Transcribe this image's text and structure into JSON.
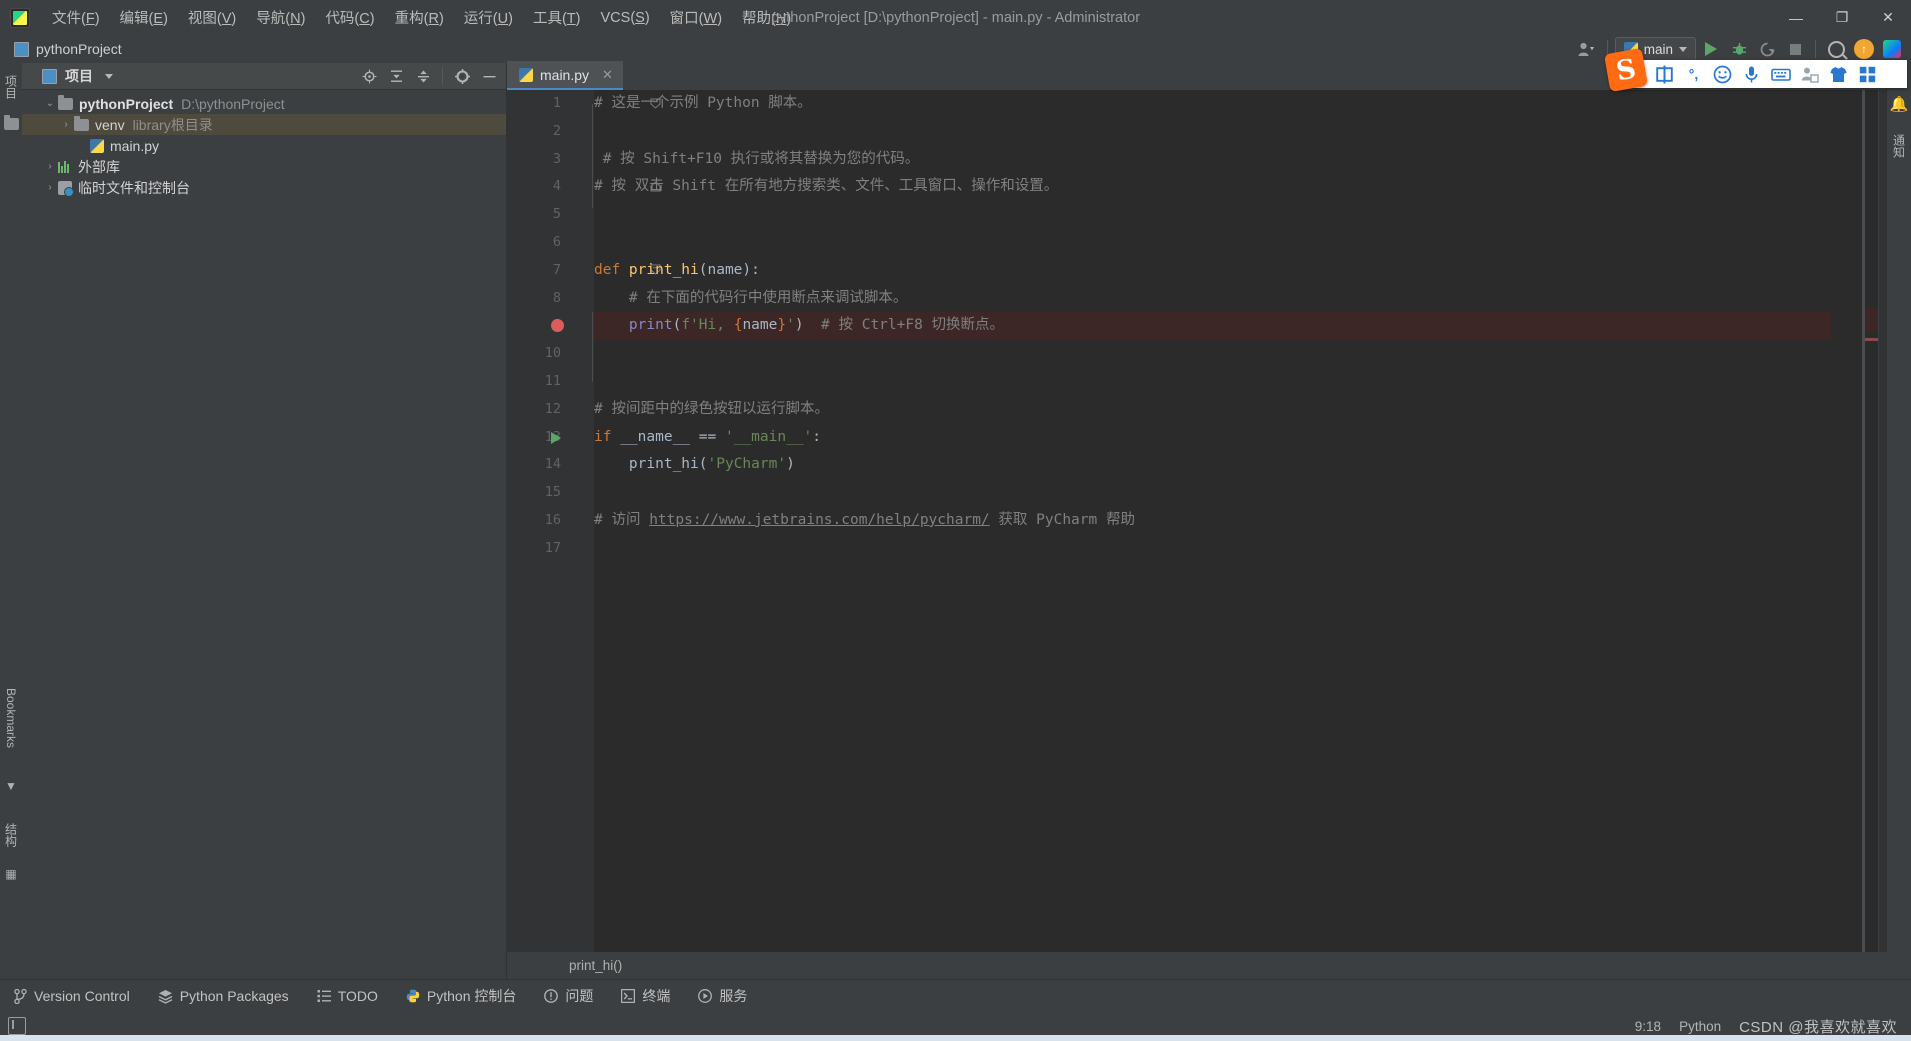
{
  "window": {
    "title": "pythonProject [D:\\pythonProject] - main.py - Administrator",
    "logo": "pycharm-logo",
    "minimize": "—",
    "maximize": "❐",
    "close": "✕"
  },
  "menubar": {
    "items": [
      {
        "label": "文件(F)",
        "name": "menu-file"
      },
      {
        "label": "编辑(E)",
        "name": "menu-edit"
      },
      {
        "label": "视图(V)",
        "name": "menu-view"
      },
      {
        "label": "导航(N)",
        "name": "menu-navigate"
      },
      {
        "label": "代码(C)",
        "name": "menu-code"
      },
      {
        "label": "重构(R)",
        "name": "menu-refactor"
      },
      {
        "label": "运行(U)",
        "name": "menu-run"
      },
      {
        "label": "工具(T)",
        "name": "menu-tools"
      },
      {
        "label": "VCS(S)",
        "name": "menu-vcs"
      },
      {
        "label": "窗口(W)",
        "name": "menu-window"
      },
      {
        "label": "帮助(H)",
        "name": "menu-help"
      }
    ]
  },
  "navbar": {
    "breadcrumb": "pythonProject",
    "run_config": "main",
    "icons": {
      "account": "account-icon",
      "run": "run-icon",
      "debug": "debug-icon",
      "coverage": "coverage-icon",
      "stop": "stop-icon",
      "search": "search-everywhere-icon",
      "update": "update-icon",
      "ide_features": "ide-features-trainer-icon",
      "more": "more-options-icon",
      "notifications": "notifications-icon"
    }
  },
  "left_strip": {
    "structure_label": "结构",
    "bookmarks_label": "Bookmarks",
    "project_label": "项目"
  },
  "right_strip": {
    "notifications_label": "通知"
  },
  "project_panel": {
    "title": "项目",
    "toolbar": {
      "locate": "locate-icon",
      "expand_all": "expand-all-icon",
      "collapse_all": "collapse-all-icon",
      "settings": "settings-gear-icon",
      "hide": "hide-panel-icon"
    },
    "tree": [
      {
        "name": "pythonProject",
        "path": "D:\\pythonProject",
        "twisty": "⌄",
        "icon": "folder-icon",
        "depth": 0,
        "bold": true,
        "selected": false
      },
      {
        "name": "venv",
        "path": "library根目录",
        "twisty": "›",
        "icon": "folder-icon",
        "depth": 1,
        "bold": false,
        "selected": true
      },
      {
        "name": "main.py",
        "path": "",
        "twisty": "",
        "icon": "python-file-icon",
        "depth": 2,
        "bold": false,
        "selected": false
      },
      {
        "name": "外部库",
        "path": "",
        "twisty": "›",
        "icon": "external-libraries-icon",
        "depth": 0,
        "bold": false,
        "selected": false
      },
      {
        "name": "临时文件和控制台",
        "path": "",
        "twisty": "›",
        "icon": "scratches-consoles-icon",
        "depth": 0,
        "bold": false,
        "selected": false
      }
    ]
  },
  "editor": {
    "tab": {
      "label": "main.py",
      "icon": "python-file-icon",
      "close": "✕"
    },
    "breadcrumb": "print_hi()",
    "inspection_status": "no-errors-checkmark",
    "lines": [
      {
        "n": 1,
        "marker": "",
        "fold": "minus",
        "hl": false,
        "tokens": [
          {
            "t": "# 这是一个示例 Python 脚本。",
            "c": "c-cmt"
          }
        ]
      },
      {
        "n": 2,
        "marker": "",
        "fold": "",
        "hl": false,
        "tokens": []
      },
      {
        "n": 3,
        "marker": "",
        "fold": "",
        "hl": false,
        "tokens": [
          {
            "t": " # 按 Shift+F10 执行或将其替换为您的代码。",
            "c": "c-cmt"
          }
        ]
      },
      {
        "n": 4,
        "marker": "",
        "fold": "end",
        "hl": false,
        "tokens": [
          {
            "t": "# 按 双击 Shift 在所有地方搜索类、文件、工具窗口、操作和设置。",
            "c": "c-cmt"
          }
        ]
      },
      {
        "n": 5,
        "marker": "",
        "fold": "",
        "hl": false,
        "tokens": []
      },
      {
        "n": 6,
        "marker": "",
        "fold": "",
        "hl": false,
        "tokens": []
      },
      {
        "n": 7,
        "marker": "",
        "fold": "minus",
        "hl": false,
        "tokens": [
          {
            "t": "def ",
            "c": "c-kw"
          },
          {
            "t": "print_hi",
            "c": "c-fn"
          },
          {
            "t": "(name):",
            "c": "c-plain"
          }
        ]
      },
      {
        "n": 8,
        "marker": "",
        "fold": "",
        "hl": false,
        "tokens": [
          {
            "t": "    # 在下面的代码行中使用断点来调试脚本。",
            "c": "c-cmt"
          }
        ]
      },
      {
        "n": 9,
        "marker": "breakpoint",
        "fold": "end",
        "hl": true,
        "tokens": [
          {
            "t": "    ",
            "c": "c-plain"
          },
          {
            "t": "print",
            "c": "c-builtin"
          },
          {
            "t": "(",
            "c": "c-plain"
          },
          {
            "t": "f'Hi, ",
            "c": "c-str"
          },
          {
            "t": "{",
            "c": "c-fstr-brace"
          },
          {
            "t": "name",
            "c": "c-plain"
          },
          {
            "t": "}",
            "c": "c-fstr-brace"
          },
          {
            "t": "'",
            "c": "c-str"
          },
          {
            "t": ")",
            "c": "c-plain"
          },
          {
            "t": "  # 按 Ctrl+F8 切换断点。",
            "c": "c-cmt"
          }
        ]
      },
      {
        "n": 10,
        "marker": "",
        "fold": "",
        "hl": false,
        "tokens": []
      },
      {
        "n": 11,
        "marker": "",
        "fold": "",
        "hl": false,
        "tokens": []
      },
      {
        "n": 12,
        "marker": "",
        "fold": "",
        "hl": false,
        "tokens": [
          {
            "t": "# 按间距中的绿色按钮以运行脚本。",
            "c": "c-cmt"
          }
        ]
      },
      {
        "n": 13,
        "marker": "run",
        "fold": "",
        "hl": false,
        "tokens": [
          {
            "t": "if ",
            "c": "c-kw"
          },
          {
            "t": "__name__ ",
            "c": "c-plain"
          },
          {
            "t": "== ",
            "c": "c-plain"
          },
          {
            "t": "'__main__'",
            "c": "c-str"
          },
          {
            "t": ":",
            "c": "c-plain"
          }
        ]
      },
      {
        "n": 14,
        "marker": "",
        "fold": "",
        "hl": false,
        "tokens": [
          {
            "t": "    print_hi(",
            "c": "c-plain"
          },
          {
            "t": "'PyCharm'",
            "c": "c-str"
          },
          {
            "t": ")",
            "c": "c-plain"
          }
        ]
      },
      {
        "n": 15,
        "marker": "",
        "fold": "",
        "hl": false,
        "tokens": []
      },
      {
        "n": 16,
        "marker": "",
        "fold": "",
        "hl": false,
        "tokens": [
          {
            "t": "# 访问 ",
            "c": "c-cmt"
          },
          {
            "t": "https://www.jetbrains.com/help/pycharm/",
            "c": "c-url"
          },
          {
            "t": " 获取 PyCharm 帮助",
            "c": "c-cmt"
          }
        ]
      },
      {
        "n": 17,
        "marker": "",
        "fold": "",
        "hl": false,
        "tokens": []
      }
    ]
  },
  "bottom_bar": {
    "items": [
      {
        "label": "Version Control",
        "icon": "branch-icon",
        "name": "tool-version-control"
      },
      {
        "label": "Python Packages",
        "icon": "packages-icon",
        "name": "tool-python-packages"
      },
      {
        "label": "TODO",
        "icon": "todo-icon",
        "name": "tool-todo"
      },
      {
        "label": "Python 控制台",
        "icon": "python-console-icon",
        "name": "tool-python-console"
      },
      {
        "label": "问题",
        "icon": "problems-icon",
        "name": "tool-problems"
      },
      {
        "label": "终端",
        "icon": "terminal-icon",
        "name": "tool-terminal"
      },
      {
        "label": "服务",
        "icon": "services-icon",
        "name": "tool-services"
      }
    ]
  },
  "status_bar": {
    "caret_position": "9:18",
    "interpreter": "Python",
    "watermark": "CSDN @我喜欢就喜欢",
    "memory_icon": "memory-indicator-icon"
  },
  "ime_bar": {
    "logo": "S",
    "buttons": [
      {
        "glyph": "中",
        "name": "ime-chinese-mode-button"
      },
      {
        "glyph": "°,",
        "name": "ime-punctuation-button"
      },
      {
        "glyph": "☺",
        "name": "ime-emoji-button"
      },
      {
        "glyph": "⬤",
        "name": "ime-voice-input-button"
      },
      {
        "glyph": "⌨",
        "name": "ime-soft-keyboard-button"
      },
      {
        "glyph": "▣",
        "name": "ime-user-button"
      },
      {
        "glyph": "▼",
        "name": "ime-skin-button"
      },
      {
        "glyph": "⊞",
        "name": "ime-toolbox-button"
      }
    ]
  },
  "colors": {
    "accent": "#4a88c7",
    "panel_bg": "#3c3f41",
    "editor_bg": "#2b2b2b",
    "gutter_bg": "#313335",
    "selection": "#4e4a3d",
    "breakpoint": "#db5c5c",
    "run_green": "#59a869",
    "string": "#6a8759",
    "keyword": "#cc7832",
    "function": "#ffc66d",
    "comment": "#808080",
    "ime_orange": "#ff6a13",
    "ime_blue": "#2878d0"
  }
}
